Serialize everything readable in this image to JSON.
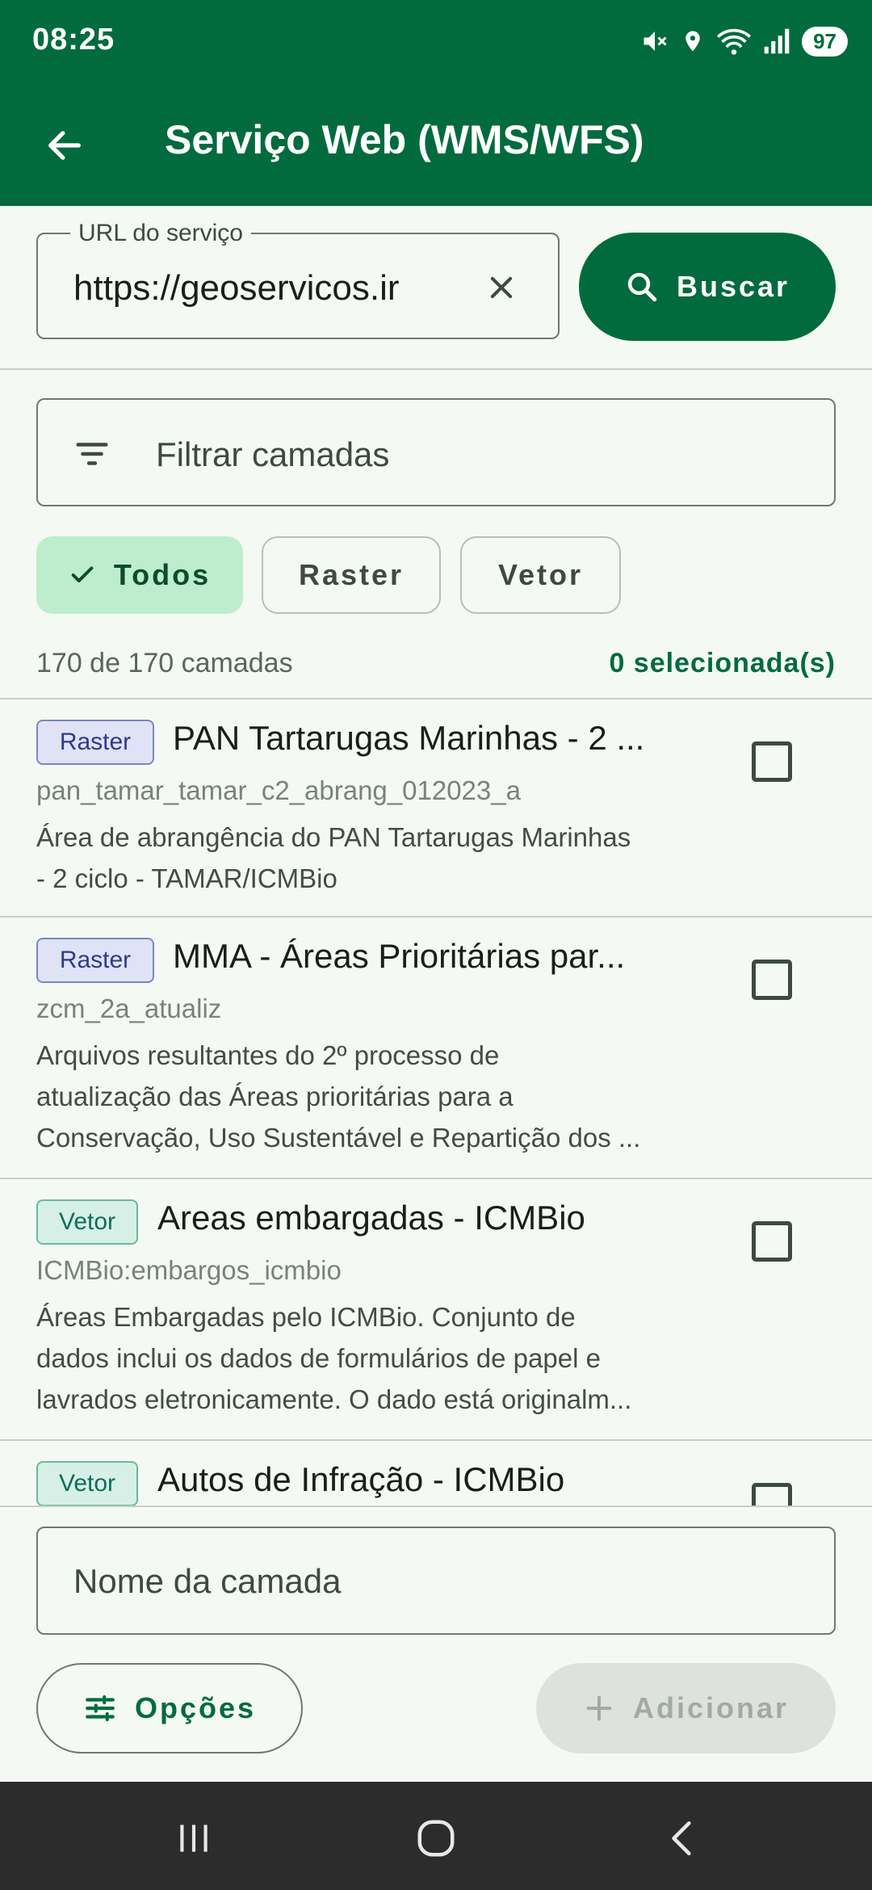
{
  "status_bar": {
    "time": "08:25",
    "battery": "97"
  },
  "app_bar": {
    "title": "Serviço Web (WMS/WFS)"
  },
  "url_field": {
    "label": "URL do serviço",
    "value": "https://geoservicos.ir"
  },
  "search_button": {
    "label": "Buscar"
  },
  "filter": {
    "placeholder": "Filtrar camadas"
  },
  "chips": [
    {
      "label": "Todos",
      "selected": true
    },
    {
      "label": "Raster",
      "selected": false
    },
    {
      "label": "Vetor",
      "selected": false
    }
  ],
  "counts": {
    "total": "170 de 170 camadas",
    "selected": "0 selecionada(s)"
  },
  "layers": [
    {
      "type": "Raster",
      "title": "PAN Tartarugas Marinhas - 2 ...",
      "name": "pan_tamar_tamar_c2_abrang_012023_a",
      "description": [
        "Área de abrangência do PAN Tartarugas Marinhas",
        "- 2 ciclo - TAMAR/ICMBio"
      ]
    },
    {
      "type": "Raster",
      "title": "MMA - Áreas Prioritárias par...",
      "name": "zcm_2a_atualiz",
      "description": [
        "Arquivos resultantes do 2º processo de",
        "atualização das Áreas prioritárias para a",
        "Conservação, Uso Sustentável e Repartição dos ..."
      ]
    },
    {
      "type": "Vetor",
      "title": "Areas embargadas - ICMBio",
      "name": "ICMBio:embargos_icmbio",
      "description": [
        "Áreas Embargadas pelo ICMBio. Conjunto de",
        "dados inclui os dados de formulários de papel e",
        "lavrados eletronicamente. O dado está originalm..."
      ]
    },
    {
      "type": "Vetor",
      "title": "Autos de Infração - ICMBio",
      "name": "",
      "description": []
    }
  ],
  "name_field": {
    "placeholder": "Nome da camada"
  },
  "options_button": {
    "label": "Opções"
  },
  "add_button": {
    "label": "Adicionar"
  },
  "colors": {
    "primary": "#026b3e",
    "background": "#f4f9f3",
    "chip_selected": "#bdedcd"
  }
}
